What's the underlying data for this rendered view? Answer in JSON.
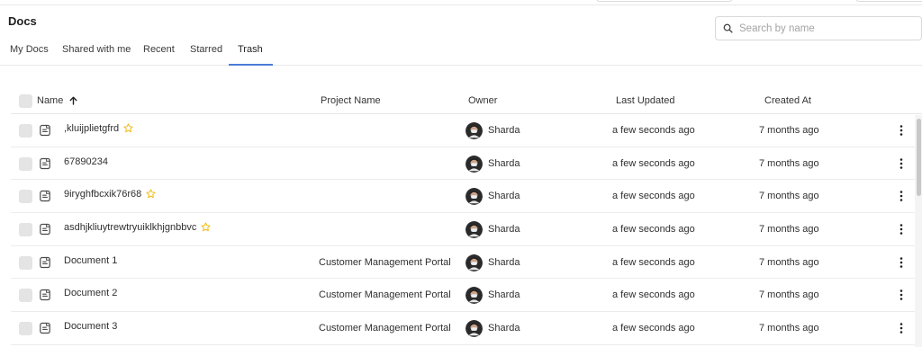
{
  "page": {
    "title": "Docs"
  },
  "search": {
    "placeholder": "Search by name",
    "value": ""
  },
  "tabs": [
    {
      "label": "My Docs",
      "active": false
    },
    {
      "label": "Shared with me",
      "active": false
    },
    {
      "label": "Recent",
      "active": false
    },
    {
      "label": "Starred",
      "active": false
    },
    {
      "label": "Trash",
      "active": true
    }
  ],
  "table": {
    "columns": {
      "name": "Name",
      "project": "Project Name",
      "owner": "Owner",
      "updated": "Last Updated",
      "created": "Created At"
    },
    "sort": {
      "column": "Name",
      "direction": "ascending",
      "icon": "arrow-up-icon"
    },
    "rows": [
      {
        "name": ",kluijplietgfrd",
        "starred": true,
        "project": "",
        "owner": "Sharda",
        "updated": "a few seconds ago",
        "created": "7 months ago"
      },
      {
        "name": "67890234",
        "starred": false,
        "project": "",
        "owner": "Sharda",
        "updated": "a few seconds ago",
        "created": "7 months ago"
      },
      {
        "name": "9iryghfbcxik76r68",
        "starred": true,
        "project": "",
        "owner": "Sharda",
        "updated": "a few seconds ago",
        "created": "7 months ago"
      },
      {
        "name": "asdhjkliuytrewtryuiklkhjgnbbvc",
        "starred": true,
        "project": "",
        "owner": "Sharda",
        "updated": "a few seconds ago",
        "created": "7 months ago"
      },
      {
        "name": "Document 1",
        "starred": false,
        "project": "Customer Management Portal",
        "owner": "Sharda",
        "updated": "a few seconds ago",
        "created": "7 months ago"
      },
      {
        "name": "Document 2",
        "starred": false,
        "project": "Customer Management Portal",
        "owner": "Sharda",
        "updated": "a few seconds ago",
        "created": "7 months ago"
      },
      {
        "name": "Document 3",
        "starred": false,
        "project": "Customer Management Portal",
        "owner": "Sharda",
        "updated": "a few seconds ago",
        "created": "7 months ago"
      }
    ]
  },
  "icons": {
    "search": "search-icon",
    "doc": "document-icon",
    "star": "star-outline-icon",
    "menu": "more-vertical-icon",
    "avatar": "user-avatar"
  },
  "colors": {
    "accent": "#4a7ad9",
    "star": "#f2b500",
    "checkbox": "#e4e4e4"
  }
}
